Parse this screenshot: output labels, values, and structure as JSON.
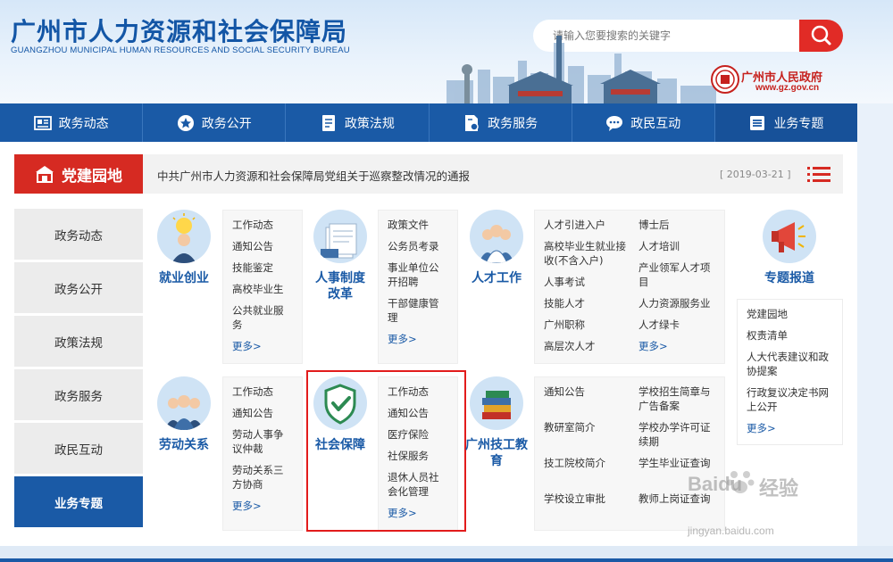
{
  "header": {
    "title_cn": "广州市人力资源和社会保障局",
    "title_en": "GUANGZHOU MUNICIPAL HUMAN RESOURCES AND SOCIAL SECURITY BUREAU",
    "search_placeholder": "请输入您要搜索的关键字",
    "gov_name": "广州市人民政府",
    "gov_url": "www.gz.gov.cn"
  },
  "nav": [
    {
      "label": "政务动态",
      "icon": "newspaper-icon"
    },
    {
      "label": "政务公开",
      "icon": "star-icon"
    },
    {
      "label": "政策法规",
      "icon": "document-icon"
    },
    {
      "label": "政务服务",
      "icon": "service-doc-icon"
    },
    {
      "label": "政民互动",
      "icon": "chat-icon"
    },
    {
      "label": "业务专题",
      "icon": "list-doc-icon"
    }
  ],
  "party": {
    "badge": "党建园地",
    "news": "中共广州市人力资源和社会保障局党组关于巡察整改情况的通报",
    "date": "[ 2019-03-21 ]"
  },
  "sidebar": [
    "政务动态",
    "政务公开",
    "政策法规",
    "政务服务",
    "政民互动",
    "业务专题"
  ],
  "cards": {
    "jiuye": {
      "title": "就业创业",
      "links": [
        "工作动态",
        "通知公告",
        "技能鉴定",
        "高校毕业生",
        "公共就业服务"
      ],
      "more": "更多>"
    },
    "renshi": {
      "title": "人事制度改革",
      "links": [
        "政策文件",
        "公务员考录",
        "事业单位公开招聘",
        "干部健康管理"
      ],
      "more": "更多>"
    },
    "rencai": {
      "title": "人才工作",
      "links_a": [
        "人才引进入户",
        "高校毕业生就业接收(不含入户)",
        "人事考试",
        "技能人才",
        "广州职称",
        "高层次人才"
      ],
      "links_b": [
        "博士后",
        "人才培训",
        "产业领军人才项目",
        "人力资源服务业",
        "人才绿卡"
      ],
      "more": "更多>"
    },
    "zhuanti": {
      "title": "专题报道",
      "links": [
        "党建园地",
        "权责清单",
        "人大代表建议和政协提案",
        "行政复议决定书网上公开"
      ],
      "more": "更多>"
    },
    "laodong": {
      "title": "劳动关系",
      "links": [
        "工作动态",
        "通知公告",
        "劳动人事争议仲裁",
        "劳动关系三方协商"
      ],
      "more": "更多>"
    },
    "shebao": {
      "title": "社会保障",
      "links": [
        "工作动态",
        "通知公告",
        "医疗保险",
        "社保服务",
        "退休人员社会化管理"
      ],
      "more": "更多>"
    },
    "jigong": {
      "title": "广州技工教育",
      "links_a": [
        "通知公告",
        "教研室简介",
        "技工院校简介",
        "学校设立审批"
      ],
      "links_b": [
        "学校招生简章与广告备案",
        "学校办学许可证续期",
        "学生毕业证查询",
        "教师上岗证查询"
      ]
    }
  },
  "watermark": {
    "brand": "Baidu",
    "brand_cn": "经验",
    "url": "jingyan.baidu.com"
  },
  "colors": {
    "primary": "#1a5aa6",
    "accent_red": "#d62a22",
    "highlight": "#e21c1c"
  }
}
